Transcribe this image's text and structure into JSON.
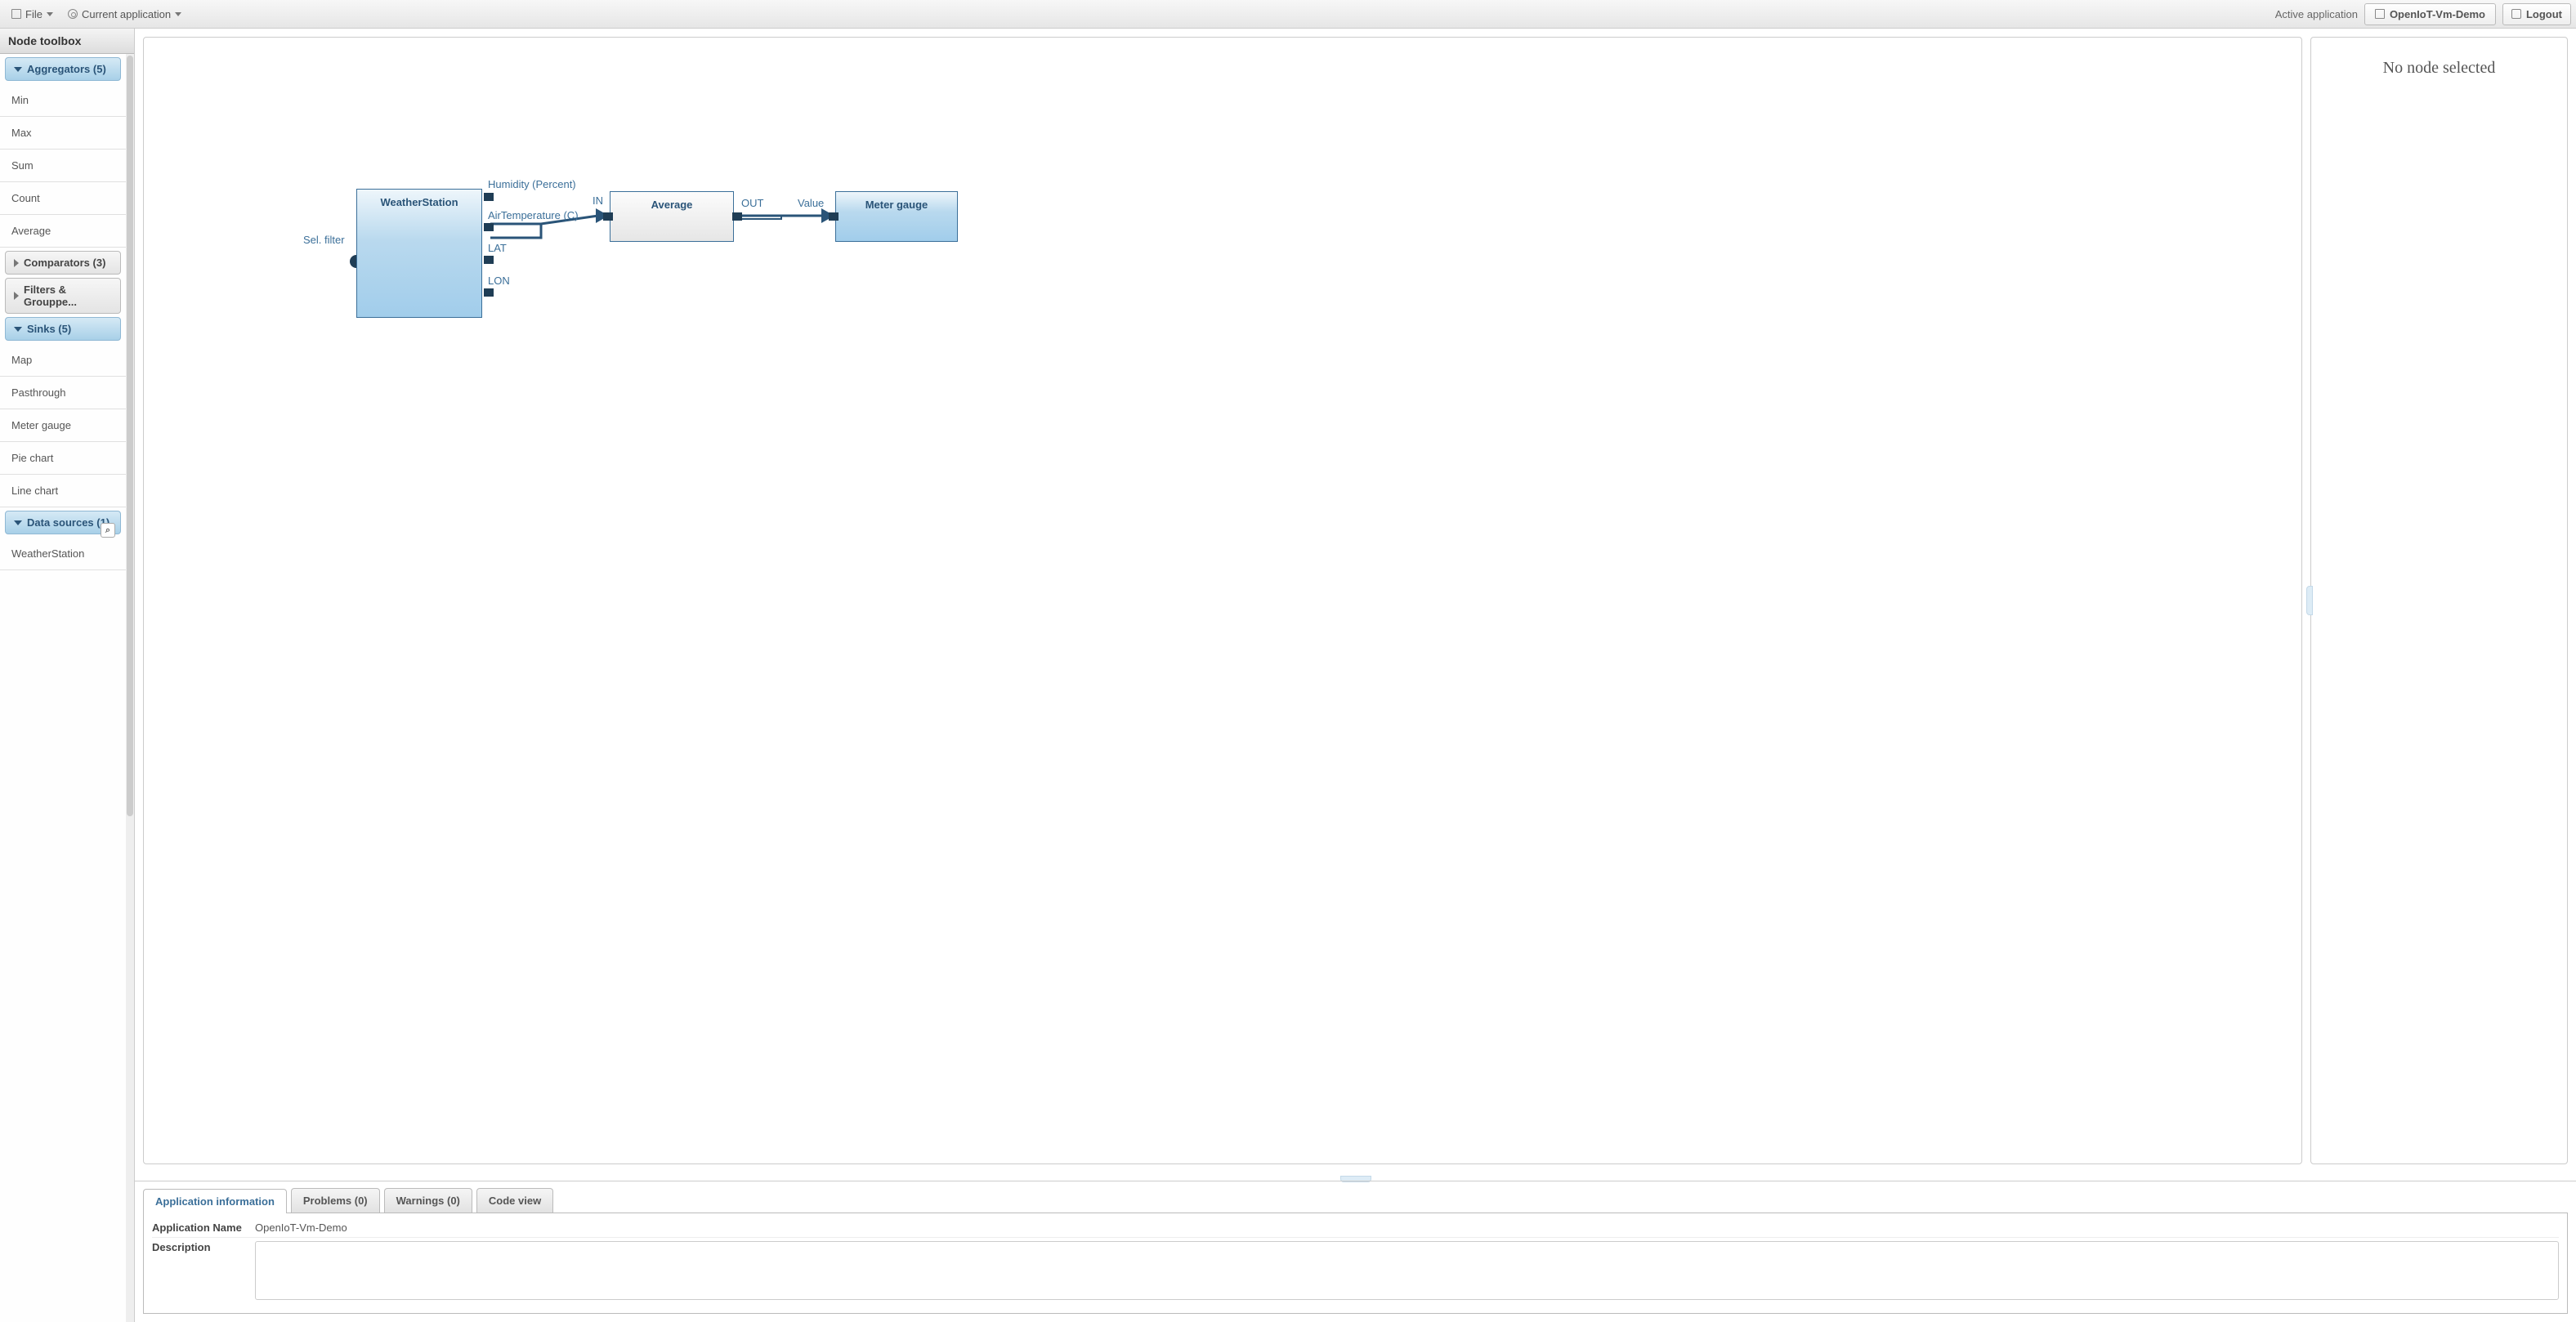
{
  "toolbar": {
    "file_label": "File",
    "current_app_label": "Current application",
    "active_label": "Active application",
    "active_app": "OpenIoT-Vm-Demo",
    "logout": "Logout"
  },
  "sidebar": {
    "title": "Node toolbox",
    "sections": {
      "aggregators": {
        "label": "Aggregators (5)",
        "items": [
          "Min",
          "Max",
          "Sum",
          "Count",
          "Average"
        ]
      },
      "comparators": {
        "label": "Comparators (3)"
      },
      "filters": {
        "label": "Filters & Grouppe..."
      },
      "sinks": {
        "label": "Sinks (5)",
        "items": [
          "Map",
          "Pasthrough",
          "Meter gauge",
          "Pie chart",
          "Line chart"
        ]
      },
      "data_sources": {
        "label": "Data sources (1)",
        "items": [
          "WeatherStation"
        ]
      }
    }
  },
  "diagram": {
    "sel_filter": "Sel. filter",
    "nodes": {
      "weather": {
        "title": "WeatherStation",
        "outputs": [
          "Humidity (Percent)",
          "AirTemperature (C)",
          "LAT",
          "LON"
        ]
      },
      "average": {
        "title": "Average",
        "in": "IN",
        "out": "OUT"
      },
      "meter": {
        "title": "Meter gauge",
        "in": "Value"
      }
    }
  },
  "inspector": {
    "empty": "No node selected"
  },
  "tabs": {
    "info": "Application information",
    "problems": "Problems (0)",
    "warnings": "Warnings (0)",
    "code": "Code view"
  },
  "app_info": {
    "name_label": "Application Name",
    "name_value": "OpenIoT-Vm-Demo",
    "desc_label": "Description",
    "desc_value": ""
  }
}
